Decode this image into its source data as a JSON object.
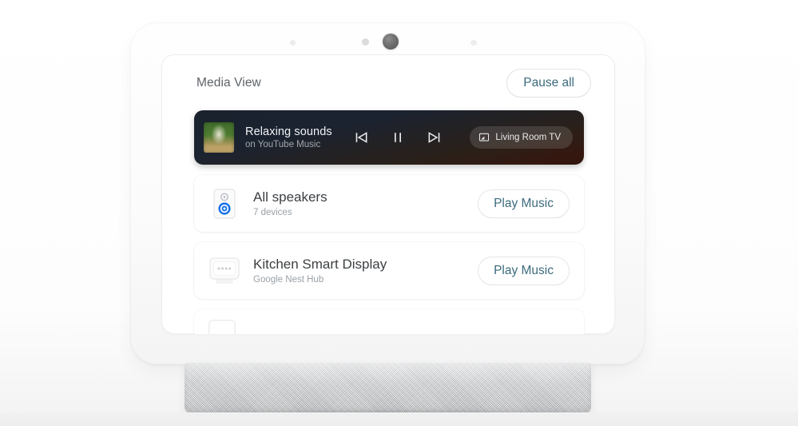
{
  "screen": {
    "header": {
      "title": "Media View",
      "pause_all_label": "Pause all"
    },
    "now_playing": {
      "track_title": "Relaxing sounds",
      "track_subtitle": "on YouTube Music",
      "album_art_icon": "album-art-nature-thumbnail",
      "controls": {
        "previous_icon": "skip-previous-icon",
        "pause_icon": "pause-icon",
        "next_icon": "skip-next-icon"
      },
      "cast_chip": {
        "label": "Living Room TV",
        "icon": "cast-tv-icon"
      }
    },
    "devices": [
      {
        "name": "All speakers",
        "subtitle": "7 devices",
        "icon": "speaker-group-icon",
        "action_label": "Play Music"
      },
      {
        "name": "Kitchen Smart Display",
        "subtitle": "Google Nest Hub",
        "icon": "smart-display-icon",
        "action_label": "Play Music"
      }
    ],
    "partial_device": {
      "icon": "smart-display-icon"
    }
  },
  "device_hardware": {
    "camera_icon": "camera-lens",
    "sensor_left_icon": "ambient-sensor",
    "sensor_mid_icon": "ambient-sensor",
    "sensor_right_icon": "ambient-sensor",
    "speaker_base_icon": "fabric-speaker-grille"
  },
  "colors": {
    "accent_link": "#3c6b7d",
    "title_text": "#5d6368",
    "device_name_text": "#3c4043",
    "subtitle_text": "#9aa0a6",
    "player_dark_top": "#1a222e",
    "player_dark_bottom": "#2f150e",
    "speaker_icon_blue": "#1a73e8",
    "base_fabric": "#d8dadc"
  }
}
